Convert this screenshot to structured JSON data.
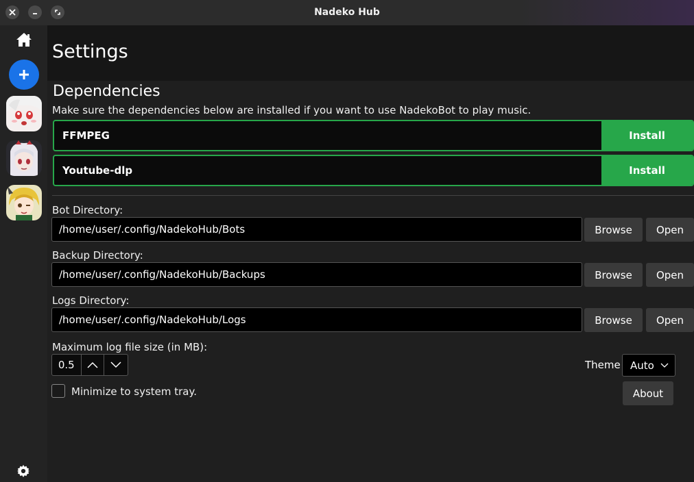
{
  "window": {
    "title": "Nadeko Hub"
  },
  "sidebar": {
    "home_icon": "home-icon",
    "add_icon": "plus-icon",
    "settings_icon": "gear-icon",
    "bots": [
      {
        "avatar": "bot-avatar-1"
      },
      {
        "avatar": "bot-avatar-2"
      },
      {
        "avatar": "bot-avatar-3"
      }
    ]
  },
  "header": {
    "title": "Settings"
  },
  "dependencies": {
    "title": "Dependencies",
    "description": "Make sure the dependencies below are installed if you want to use NadekoBot to play music.",
    "items": [
      {
        "name": "FFMPEG",
        "action": "Install"
      },
      {
        "name": "Youtube-dlp",
        "action": "Install"
      }
    ]
  },
  "directories": [
    {
      "label": "Bot Directory:",
      "value": "/home/user/.config/NadekoHub/Bots",
      "browse": "Browse",
      "open": "Open"
    },
    {
      "label": "Backup Directory:",
      "value": "/home/user/.config/NadekoHub/Backups",
      "browse": "Browse",
      "open": "Open"
    },
    {
      "label": "Logs Directory:",
      "value": "/home/user/.config/NadekoHub/Logs",
      "browse": "Browse",
      "open": "Open"
    }
  ],
  "log_size": {
    "label": "Maximum log file size (in MB):",
    "value": "0.5"
  },
  "tray": {
    "label": "Minimize to system tray.",
    "checked": false
  },
  "theme": {
    "label": "Theme",
    "value": "Auto"
  },
  "about": {
    "label": "About"
  },
  "colors": {
    "accent_green": "#27a74a",
    "accent_blue": "#1a73e8"
  }
}
